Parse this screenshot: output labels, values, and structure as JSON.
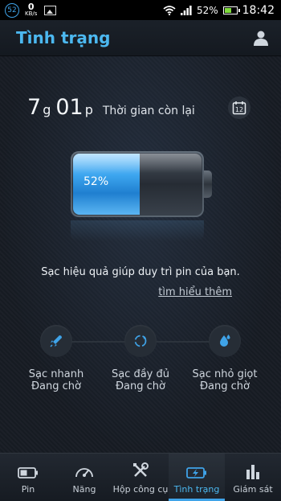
{
  "status_bar": {
    "badge": "52",
    "speed_value": "0",
    "speed_unit": "KB/s",
    "battery_pct": "52%",
    "time": "18:42"
  },
  "header": {
    "title": "Tình trạng",
    "user_icon": "user-icon"
  },
  "remaining": {
    "hours": "7",
    "hours_unit": "g",
    "minutes": "01",
    "minutes_unit": "p",
    "label": "Thời gian còn lại",
    "calendar_day": "12"
  },
  "battery": {
    "percent_text": "52%",
    "level": 0.52,
    "fill_color": "#3da6ef"
  },
  "message": {
    "text": "Sạc hiệu quả giúp duy trì pin của bạn.",
    "link": "tìm hiểu thêm"
  },
  "charge_steps": [
    {
      "title": "Sạc nhanh",
      "status": "Đang chờ",
      "icon": "rocket-icon"
    },
    {
      "title": "Sạc đầy đủ",
      "status": "Đang chờ",
      "icon": "cycle-icon"
    },
    {
      "title": "Sạc nhỏ giọt",
      "status": "Đang chờ",
      "icon": "drop-icon"
    }
  ],
  "nav": [
    {
      "label": "Pin",
      "icon": "battery-icon",
      "active": false
    },
    {
      "label": "Năng",
      "icon": "gauge-icon",
      "active": false
    },
    {
      "label": "Hộp công cụ",
      "icon": "tools-icon",
      "active": false
    },
    {
      "label": "Tình trạng",
      "icon": "charging-battery-icon",
      "active": true
    },
    {
      "label": "Giám sát",
      "icon": "bar-chart-icon",
      "active": false
    }
  ],
  "colors": {
    "accent": "#4cb8f0",
    "background": "#171c24"
  }
}
